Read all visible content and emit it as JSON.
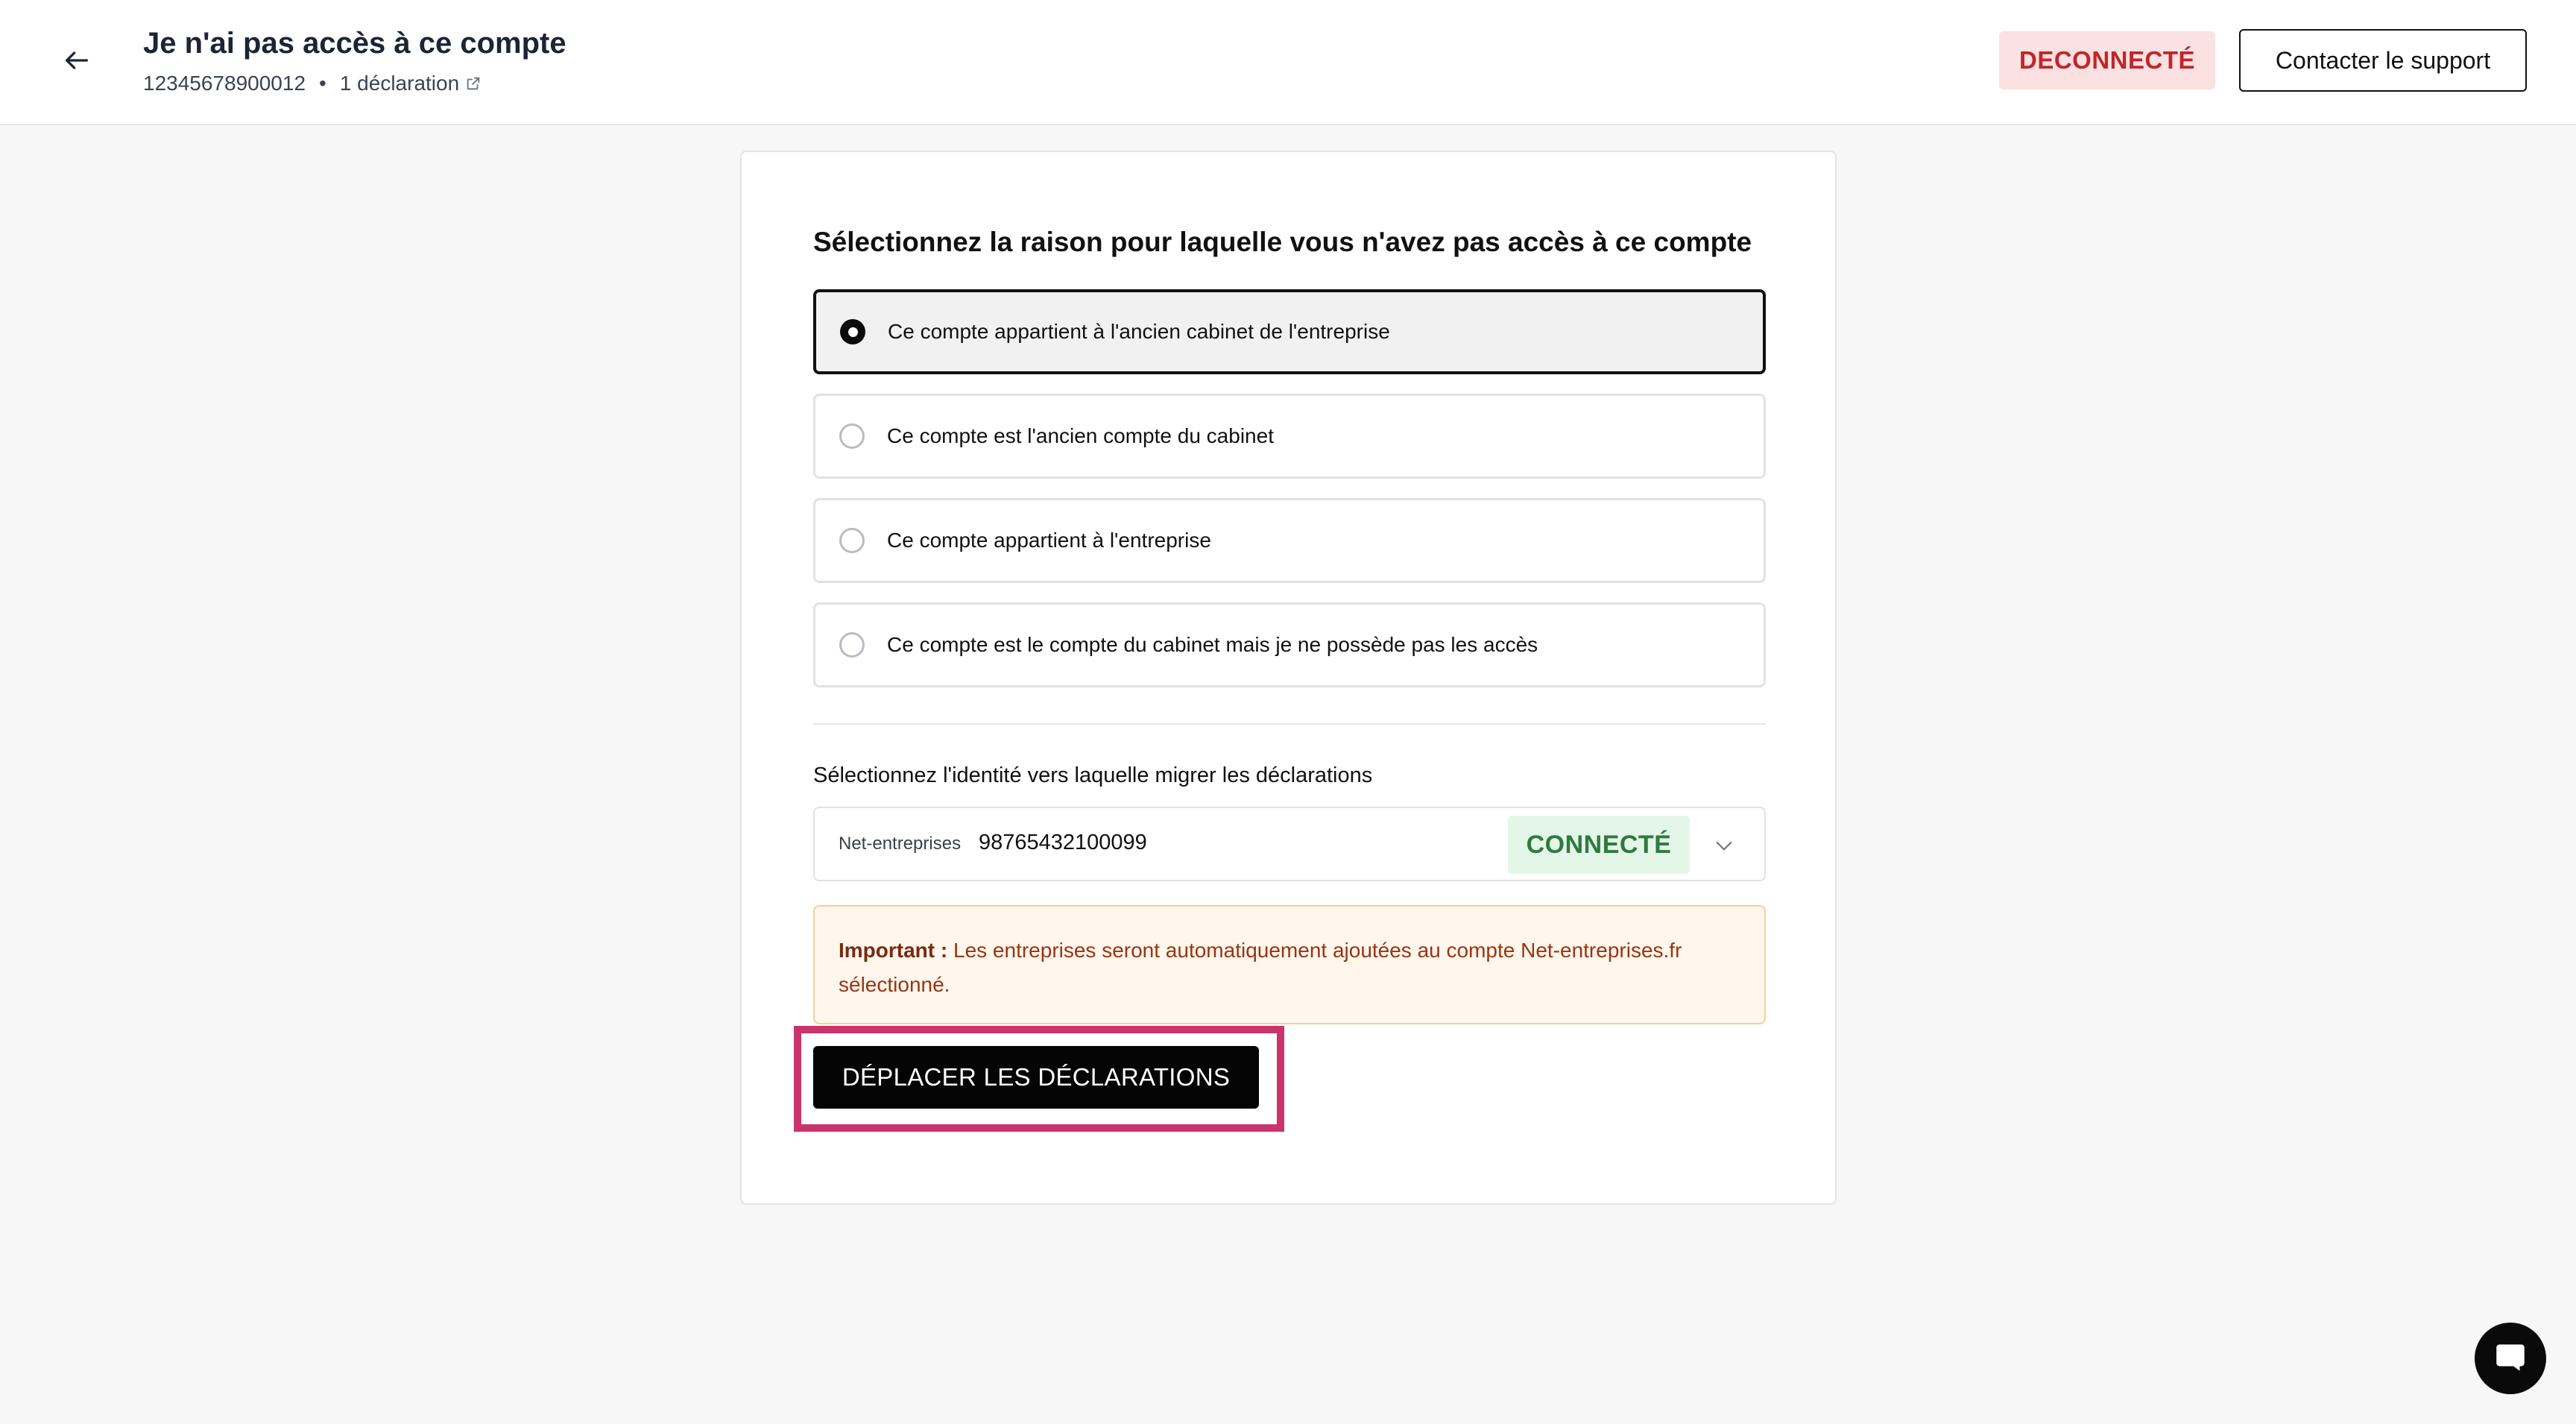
{
  "header": {
    "back_icon": "arrow-left-icon",
    "title": "Je n'ai pas accès à ce compte",
    "account_id": "12345678900012",
    "separator": "•",
    "declarations_link": "1 déclaration",
    "link_icon": "external-link-icon",
    "status_badge": "DECONNECTÉ",
    "support_button": "Contacter le support"
  },
  "form": {
    "question": "Sélectionnez la raison pour laquelle vous n'avez pas accès à ce compte",
    "options": [
      {
        "label": "Ce compte appartient à l'ancien cabinet de l'entreprise",
        "selected": true
      },
      {
        "label": "Ce compte est l'ancien compte du cabinet",
        "selected": false
      },
      {
        "label": "Ce compte appartient à l'entreprise",
        "selected": false
      },
      {
        "label": "Ce compte est le compte du cabinet mais je ne possède pas les accès",
        "selected": false
      }
    ],
    "identity_label": "Sélectionnez l'identité vers laquelle migrer les déclarations",
    "identity": {
      "provider": "Net-entreprises",
      "value": "98765432100099",
      "status": "CONNECTÉ",
      "chevron_icon": "chevron-down-icon"
    },
    "notice": {
      "bold": "Important :",
      "text": " Les entreprises seront automatiquement ajoutées au compte Net-entreprises.fr sélectionné."
    },
    "submit_button": "DÉPLACER LES DÉCLARATIONS"
  },
  "chat": {
    "icon": "chat-icon"
  },
  "colors": {
    "disconnected_bg": "#fbe1e1",
    "disconnected_text": "#c0262d",
    "connected_bg": "#e4f6e8",
    "connected_text": "#2f7a3f",
    "notice_bg": "#fff6ec",
    "notice_border": "#f6cf9c",
    "highlight_frame": "#c9346b"
  }
}
